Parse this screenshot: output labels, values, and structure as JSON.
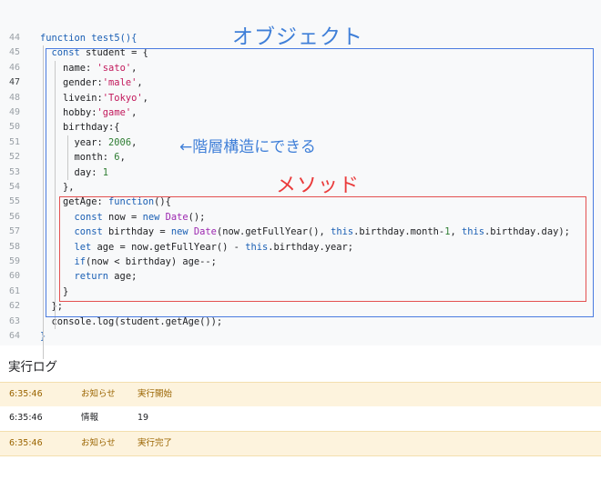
{
  "editor": {
    "lines": [
      {
        "num": "44",
        "current": false,
        "indent": 0,
        "tokens": [
          {
            "t": "function",
            "c": "kw"
          },
          {
            "t": " test5(){",
            "c": "kw"
          }
        ]
      },
      {
        "num": "45",
        "current": false,
        "indent": 1,
        "tokens": [
          {
            "t": "const",
            "c": "kw"
          },
          {
            "t": " student = {",
            "c": ""
          }
        ]
      },
      {
        "num": "46",
        "current": false,
        "indent": 2,
        "tokens": [
          {
            "t": "name: ",
            "c": ""
          },
          {
            "t": "'sato'",
            "c": "str"
          },
          {
            "t": ",",
            "c": ""
          }
        ]
      },
      {
        "num": "47",
        "current": true,
        "indent": 2,
        "tokens": [
          {
            "t": "gender:",
            "c": ""
          },
          {
            "t": "'male'",
            "c": "str"
          },
          {
            "t": ",",
            "c": ""
          }
        ]
      },
      {
        "num": "48",
        "current": false,
        "indent": 2,
        "tokens": [
          {
            "t": "livein:",
            "c": ""
          },
          {
            "t": "'Tokyo'",
            "c": "str"
          },
          {
            "t": ",",
            "c": ""
          }
        ]
      },
      {
        "num": "49",
        "current": false,
        "indent": 2,
        "tokens": [
          {
            "t": "hobby:",
            "c": ""
          },
          {
            "t": "'game'",
            "c": "str"
          },
          {
            "t": ",",
            "c": ""
          }
        ]
      },
      {
        "num": "50",
        "current": false,
        "indent": 2,
        "tokens": [
          {
            "t": "birthday:{",
            "c": ""
          }
        ]
      },
      {
        "num": "51",
        "current": false,
        "indent": 3,
        "tokens": [
          {
            "t": "year: ",
            "c": ""
          },
          {
            "t": "2006",
            "c": "num"
          },
          {
            "t": ",",
            "c": ""
          }
        ]
      },
      {
        "num": "52",
        "current": false,
        "indent": 3,
        "tokens": [
          {
            "t": "month: ",
            "c": ""
          },
          {
            "t": "6",
            "c": "num"
          },
          {
            "t": ",",
            "c": ""
          }
        ]
      },
      {
        "num": "53",
        "current": false,
        "indent": 3,
        "tokens": [
          {
            "t": "day: ",
            "c": ""
          },
          {
            "t": "1",
            "c": "num"
          }
        ]
      },
      {
        "num": "54",
        "current": false,
        "indent": 2,
        "tokens": [
          {
            "t": "},",
            "c": ""
          }
        ]
      },
      {
        "num": "55",
        "current": false,
        "indent": 2,
        "tokens": [
          {
            "t": "getAge: ",
            "c": ""
          },
          {
            "t": "function",
            "c": "kw"
          },
          {
            "t": "(){",
            "c": ""
          }
        ]
      },
      {
        "num": "56",
        "current": false,
        "indent": 3,
        "tokens": [
          {
            "t": "const",
            "c": "kw"
          },
          {
            "t": " now = ",
            "c": ""
          },
          {
            "t": "new",
            "c": "kw"
          },
          {
            "t": " ",
            "c": ""
          },
          {
            "t": "Date",
            "c": "kw2"
          },
          {
            "t": "();",
            "c": ""
          }
        ]
      },
      {
        "num": "57",
        "current": false,
        "indent": 3,
        "tokens": [
          {
            "t": "const",
            "c": "kw"
          },
          {
            "t": " birthday = ",
            "c": ""
          },
          {
            "t": "new",
            "c": "kw"
          },
          {
            "t": " ",
            "c": ""
          },
          {
            "t": "Date",
            "c": "kw2"
          },
          {
            "t": "(now.getFullYear(), ",
            "c": ""
          },
          {
            "t": "this",
            "c": "kw"
          },
          {
            "t": ".birthday.month-",
            "c": ""
          },
          {
            "t": "1",
            "c": "num"
          },
          {
            "t": ", ",
            "c": ""
          },
          {
            "t": "this",
            "c": "kw"
          },
          {
            "t": ".birthday.day);",
            "c": ""
          }
        ]
      },
      {
        "num": "58",
        "current": false,
        "indent": 3,
        "tokens": [
          {
            "t": "let",
            "c": "kw"
          },
          {
            "t": " age = now.getFullYear() - ",
            "c": ""
          },
          {
            "t": "this",
            "c": "kw"
          },
          {
            "t": ".birthday.year;",
            "c": ""
          }
        ]
      },
      {
        "num": "59",
        "current": false,
        "indent": 3,
        "tokens": [
          {
            "t": "if",
            "c": "kw"
          },
          {
            "t": "(now < birthday) age--;",
            "c": ""
          }
        ]
      },
      {
        "num": "60",
        "current": false,
        "indent": 3,
        "tokens": [
          {
            "t": "return",
            "c": "kw"
          },
          {
            "t": " age;",
            "c": ""
          }
        ]
      },
      {
        "num": "61",
        "current": false,
        "indent": 2,
        "tokens": [
          {
            "t": "}",
            "c": ""
          }
        ]
      },
      {
        "num": "62",
        "current": false,
        "indent": 1,
        "tokens": [
          {
            "t": "};",
            "c": ""
          }
        ]
      },
      {
        "num": "63",
        "current": false,
        "indent": 1,
        "tokens": [
          {
            "t": "console.log(student.getAge());",
            "c": ""
          }
        ]
      },
      {
        "num": "64",
        "current": false,
        "indent": 0,
        "tokens": [
          {
            "t": "}",
            "c": "kw"
          }
        ]
      }
    ]
  },
  "annotations": {
    "object": "オブジェクト",
    "method": "メソッド",
    "hierarchy": "←階層構造にできる"
  },
  "log": {
    "title": "実行ログ",
    "rows": [
      {
        "time": "6:35:46",
        "level": "お知らせ",
        "message": "実行開始",
        "kind": "notice"
      },
      {
        "time": "6:35:46",
        "level": "情報",
        "message": "19",
        "kind": "info"
      },
      {
        "time": "6:35:46",
        "level": "お知らせ",
        "message": "実行完了",
        "kind": "notice"
      }
    ]
  },
  "colors": {
    "object_box": "#4a7be0",
    "method_box": "#e35050",
    "notice_bg": "#fdf3dd",
    "notice_text": "#9a6400"
  }
}
